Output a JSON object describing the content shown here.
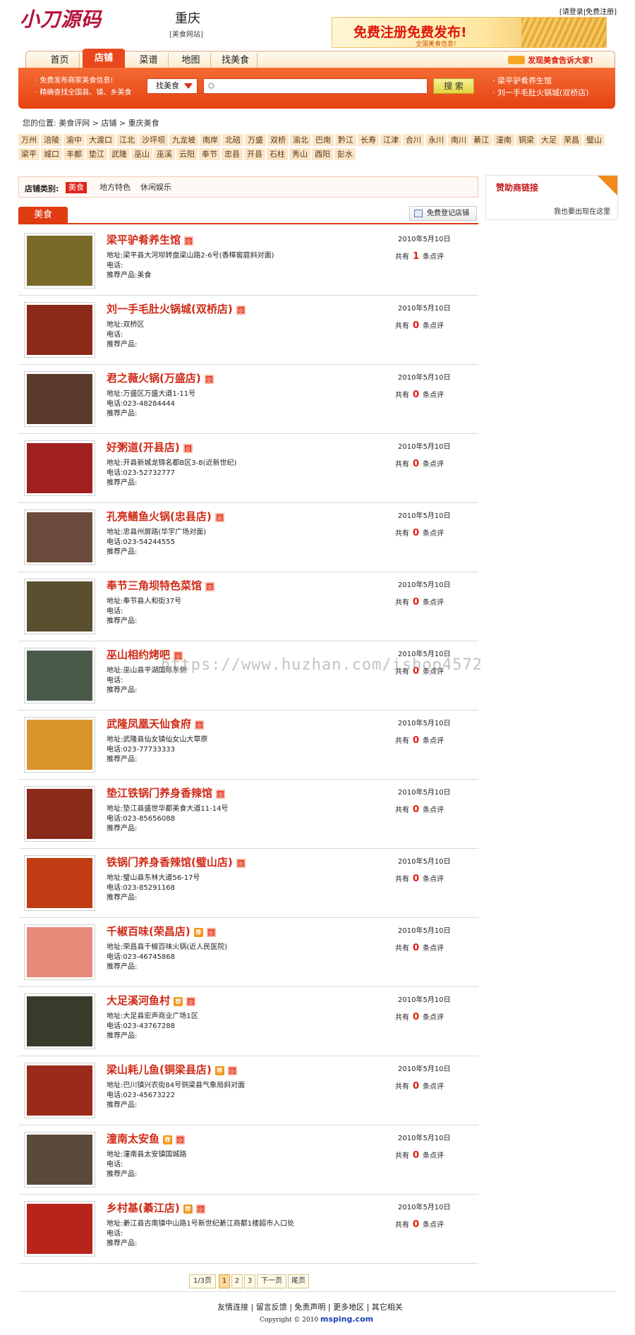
{
  "header": {
    "logo_text": "小刀源码",
    "city": "重庆",
    "city_sub": "[美食网站]",
    "top_links": "[请登录|免费注册]",
    "banner_title": "免费注册免费发布!",
    "banner_sub": "全国美食信息!"
  },
  "nav": {
    "items": [
      "首页",
      "店铺",
      "菜谱",
      "地图",
      "找美食"
    ],
    "active": "店铺",
    "notice": "发现美食告诉大家!"
  },
  "searchbar": {
    "left_lines": [
      "· 免费发布商家美食信息!",
      "· 精确查找全国县、镇、乡美食"
    ],
    "select_value": "找美食",
    "input_value": "",
    "button_label": "搜 索",
    "right_links": [
      "· 梁平驴肴养生馆",
      "· 刘一手毛肚火锅城(双桥店)"
    ]
  },
  "breadcrumb": "您的位置: 美食评网 > 店铺 > 重庆美食",
  "regions": [
    "万州",
    "涪陵",
    "渝中",
    "大渡口",
    "江北",
    "沙坪坝",
    "九龙坡",
    "南岸",
    "北碚",
    "万盛",
    "双桥",
    "渝北",
    "巴南",
    "黔江",
    "长寿",
    "江津",
    "合川",
    "永川",
    "南川",
    "綦江",
    "潼南",
    "铜梁",
    "大足",
    "荣昌",
    "璧山",
    "梁平",
    "城口",
    "丰都",
    "垫江",
    "武隆",
    "巫山",
    "巫溪",
    "云阳",
    "奉节",
    "忠县",
    "开县",
    "石柱",
    "秀山",
    "酉阳",
    "彭水"
  ],
  "category": {
    "label": "店铺类别:",
    "items": [
      "美食",
      "地方特色",
      "休闲娱乐"
    ],
    "active": "美食"
  },
  "sponsor": {
    "title": "赞助商链接",
    "text": "我也要出现在这里"
  },
  "list": {
    "tab": "美食",
    "register_btn": "免费登记店铺",
    "addr_label": "地址:",
    "phone_label": "电话:",
    "product_label": "推荐产品:",
    "count_prefix": "共有",
    "count_suffix": "条点评",
    "rows": [
      {
        "title": "梁平驴肴养生馆",
        "rec": false,
        "address": "梁平县大河坝转盘梁山路2-6号(香樟窖庭斜对面)",
        "phone": "",
        "product": "美食",
        "date": "2010年5月10日",
        "reviews": "1",
        "thumb_color": "#7a6a2a"
      },
      {
        "title": "刘一手毛肚火锅城(双桥店)",
        "rec": false,
        "address": "双桥区",
        "phone": "",
        "product": "",
        "date": "2010年5月10日",
        "reviews": "0",
        "thumb_color": "#8c2a1a"
      },
      {
        "title": "君之薇火锅(万盛店)",
        "rec": false,
        "address": "万盛区万盛大道1-11号",
        "phone": "023-48284444",
        "product": "",
        "date": "2010年5月10日",
        "reviews": "0",
        "thumb_color": "#5a3a2a"
      },
      {
        "title": "好粥道(开县店)",
        "rec": false,
        "address": "开县新城龙锦名都B区3-8(近新世纪)",
        "phone": "023-52732777",
        "product": "",
        "date": "2010年5月10日",
        "reviews": "0",
        "thumb_color": "#a02020"
      },
      {
        "title": "孔亮鳝鱼火锅(忠县店)",
        "rec": false,
        "address": "忠县州屏路(华宇广场对面)",
        "phone": "023-54244555",
        "product": "",
        "date": "2010年5月10日",
        "reviews": "0",
        "thumb_color": "#6a4a3a"
      },
      {
        "title": "奉节三角坝特色菜馆",
        "rec": false,
        "address": "奉节县人和街37号",
        "phone": "",
        "product": "",
        "date": "2010年5月10日",
        "reviews": "0",
        "thumb_color": "#5a5030"
      },
      {
        "title": "巫山相约烤吧",
        "rec": false,
        "address": "巫山县平湖国际东侧",
        "phone": "",
        "product": "",
        "date": "2010年5月10日",
        "reviews": "0",
        "thumb_color": "#4a5a4a"
      },
      {
        "title": "武隆凤凰天仙食府",
        "rec": false,
        "address": "武隆县仙女镇仙女山大草原",
        "phone": "023-77733333",
        "product": "",
        "date": "2010年5月10日",
        "reviews": "0",
        "thumb_color": "#d9942a"
      },
      {
        "title": "垫江铁锅门养身香辣馆",
        "rec": false,
        "address": "垫江县盛世华都美食大道11-14号",
        "phone": "023-85656088",
        "product": "",
        "date": "2010年5月10日",
        "reviews": "0",
        "thumb_color": "#8a2a1a"
      },
      {
        "title": "铁锅门养身香辣馆(璧山店)",
        "rec": false,
        "address": "璧山县东林大道56-17号",
        "phone": "023-85291168",
        "product": "",
        "date": "2010年5月10日",
        "reviews": "0",
        "thumb_color": "#c03a12"
      },
      {
        "title": "千椒百味(荣昌店)",
        "rec": true,
        "address": "荣昌县千椒百味火锅(近人民医院)",
        "phone": "023-46745868",
        "product": "",
        "date": "2010年5月10日",
        "reviews": "0",
        "thumb_color": "#e88a7a"
      },
      {
        "title": "大足溪河鱼村",
        "rec": true,
        "address": "大足县宏声商业广场1区",
        "phone": "023-43767288",
        "product": "",
        "date": "2010年5月10日",
        "reviews": "0",
        "thumb_color": "#3a3a2a"
      },
      {
        "title": "梁山耗儿鱼(铜梁县店)",
        "rec": true,
        "address": "巴川镇兴农街84号铜梁县气象局斜对面",
        "phone": "023-45673222",
        "product": "",
        "date": "2010年5月10日",
        "reviews": "0",
        "thumb_color": "#9a2a1a"
      },
      {
        "title": "潼南太安鱼",
        "rec": true,
        "address": "潼南县太安镇国城路",
        "phone": "",
        "product": "",
        "date": "2010年5月10日",
        "reviews": "0",
        "thumb_color": "#5a4a3a"
      },
      {
        "title": "乡村基(綦江店)",
        "rec": true,
        "address": "綦江县古南镇中山路1号新世纪綦江商都1楼超市入口处",
        "phone": "",
        "product": "",
        "date": "2010年5月10日",
        "reviews": "0",
        "thumb_color": "#b8241a"
      }
    ]
  },
  "pager": {
    "info": "1/3页",
    "pages": [
      "1",
      "2",
      "3"
    ],
    "current": "1",
    "next": "下一页",
    "last": "尾页"
  },
  "footer": {
    "links": "友情连接 | 留言反馈 | 免责声明 | 更多地区 | 其它相关",
    "copyright": "Copyright © 2010",
    "domain": "msping.com"
  },
  "watermark": "https://www.huzhan.com/ishop4572",
  "colors": {
    "accent": "#e8481c",
    "title_red": "#d02a17",
    "region_bg": "#fbe6c9"
  }
}
